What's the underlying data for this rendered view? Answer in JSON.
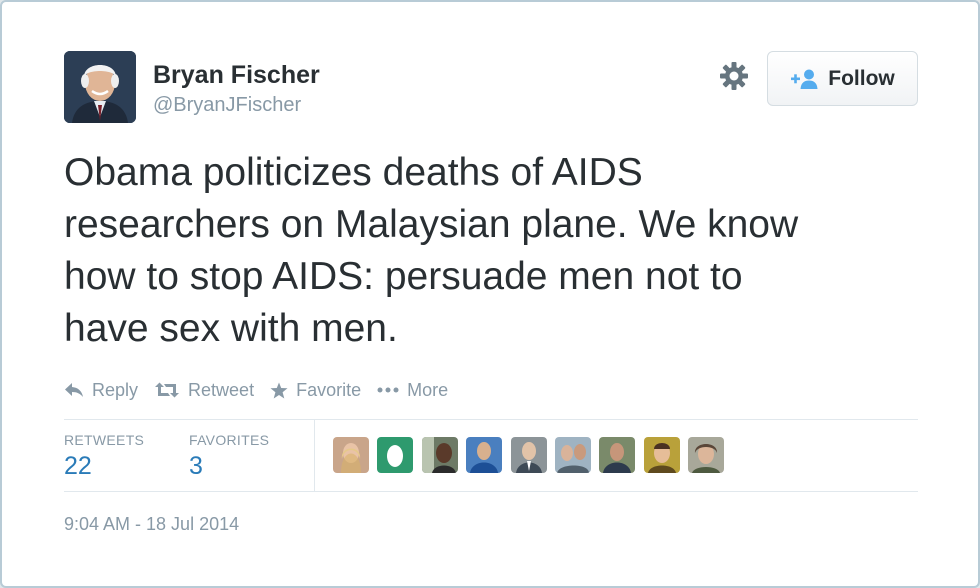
{
  "author": {
    "name": "Bryan Fischer",
    "handle": "@BryanJFischer",
    "avatar_icon": "profile-photo-icon"
  },
  "follow_button": {
    "label": "Follow",
    "icon": "add-user-icon"
  },
  "settings_icon": "gear-icon",
  "tweet": {
    "text": "Obama politicizes deaths of AIDS\nresearchers on Malaysian plane. We know\nhow to stop AIDS: persuade men not to\nhave sex with men."
  },
  "actions": [
    {
      "label": "Reply",
      "icon": "reply-icon"
    },
    {
      "label": "Retweet",
      "icon": "retweet-icon"
    },
    {
      "label": "Favorite",
      "icon": "star-icon"
    },
    {
      "label": "More",
      "icon": "more-dots-icon"
    }
  ],
  "stats": {
    "retweets_label": "RETWEETS",
    "retweets_count": "22",
    "favorites_label": "FAVORITES",
    "favorites_count": "3"
  },
  "favorited_by_count_shown": 9,
  "timestamp": "9:04 AM - 18 Jul 2014",
  "colors": {
    "text": "#292f33",
    "muted": "#8899a6",
    "link": "#2a7bb8",
    "border": "#e1e8ed"
  }
}
